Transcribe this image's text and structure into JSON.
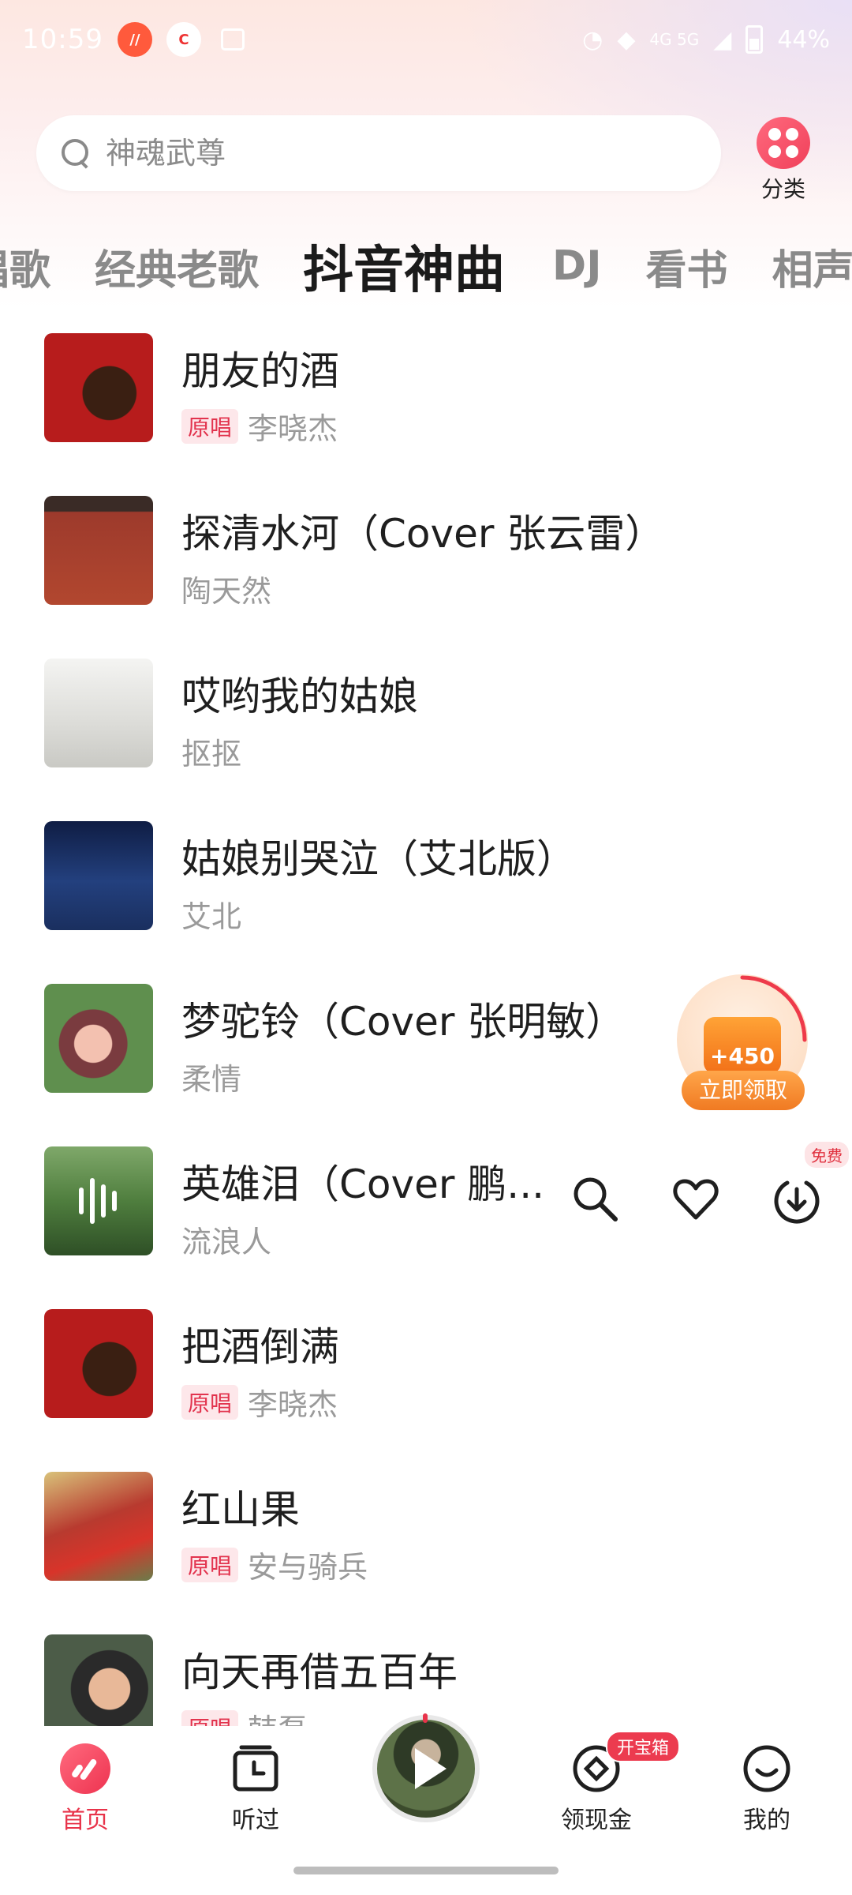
{
  "status_bar": {
    "time": "10:59",
    "network": "4G 5G",
    "battery": "44%"
  },
  "search": {
    "placeholder": "神魂武尊"
  },
  "category": {
    "label": "分类"
  },
  "tabs": [
    {
      "label": "唱歌"
    },
    {
      "label": "经典老歌"
    },
    {
      "label": "抖音神曲",
      "active": true
    },
    {
      "label": "DJ"
    },
    {
      "label": "看书"
    },
    {
      "label": "相声"
    }
  ],
  "songs": [
    {
      "title": "朋友的酒",
      "badge": "原唱",
      "artist": "李晓杰"
    },
    {
      "title": "探清水河（Cover 张云雷）",
      "badge": "",
      "artist": "陶天然"
    },
    {
      "title": "哎哟我的姑娘",
      "badge": "",
      "artist": "抠抠"
    },
    {
      "title": "姑娘别哭泣（艾北版）",
      "badge": "",
      "artist": "艾北"
    },
    {
      "title": "梦驼铃（Cover 张明敏）",
      "badge": "",
      "artist": "柔情"
    },
    {
      "title": "英雄泪（Cover 鹏...",
      "badge": "",
      "artist": "流浪人"
    },
    {
      "title": "把酒倒满",
      "badge": "原唱",
      "artist": "李晓杰"
    },
    {
      "title": "红山果",
      "badge": "原唱",
      "artist": "安与骑兵"
    },
    {
      "title": "向天再借五百年",
      "badge": "原唱",
      "artist": "韩磊"
    }
  ],
  "row_actions": {
    "free_badge": "免费"
  },
  "reward": {
    "amount": "+450",
    "button": "立即领取"
  },
  "bottom_nav": {
    "home": "首页",
    "history": "听过",
    "cash": "领现金",
    "cash_badge": "开宝箱",
    "mine": "我的"
  },
  "colors": {
    "accent": "#e8334a",
    "reward_orange": "#f07a22"
  }
}
